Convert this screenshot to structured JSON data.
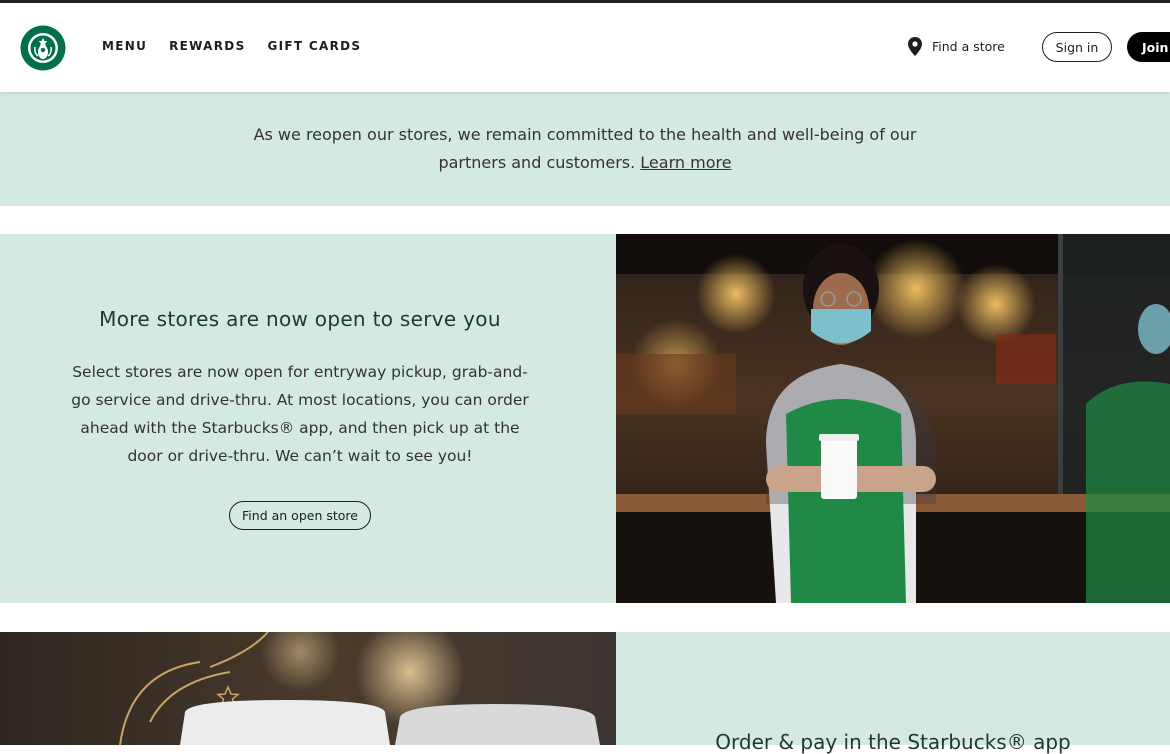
{
  "header": {
    "nav": [
      "MENU",
      "REWARDS",
      "GIFT CARDS"
    ],
    "find_store": "Find a store",
    "sign_in": "Sign in",
    "join": "Join now"
  },
  "banner": {
    "text": "As we reopen our stores, we remain committed to the health and well-being of our partners and customers.",
    "link": "Learn more"
  },
  "promo1": {
    "heading": "More stores are now open to serve you",
    "body": "Select stores are now open for entryway pickup, grab-and-go service and drive-thru. At most locations, you can order ahead with the Starbucks® app, and then pick up at the door or drive-thru. We can’t wait to see you!",
    "button": "Find an open store"
  },
  "promo2": {
    "heading": "Order & pay in the Starbucks® app"
  },
  "colors": {
    "mint": "#d4e9e2",
    "brand_green": "#00704a",
    "dark_green": "#1e3932"
  },
  "icons": [
    "siren-logo",
    "location-pin-icon"
  ]
}
